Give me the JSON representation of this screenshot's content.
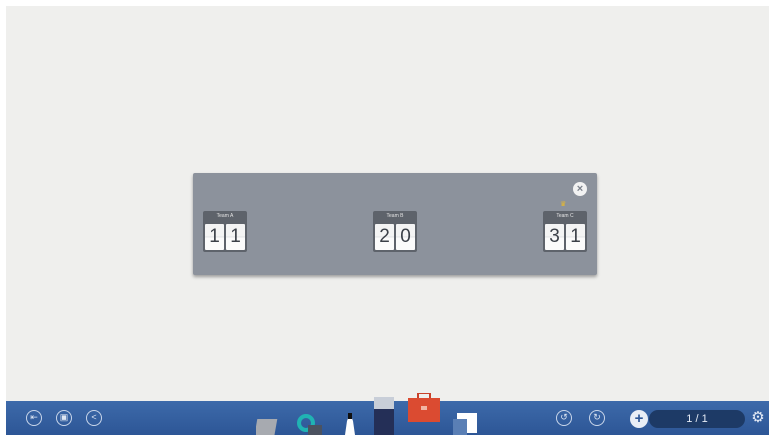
{
  "scoreboard": {
    "close_icon": "×",
    "crown_icon": "♛",
    "teams": [
      {
        "label": "Team A",
        "digits": [
          "1",
          "1"
        ]
      },
      {
        "label": "Team B",
        "digits": [
          "2",
          "0"
        ]
      },
      {
        "label": "Team C",
        "digits": [
          "3",
          "1"
        ]
      }
    ]
  },
  "toolbar": {
    "exit_icon": "⇤",
    "save_icon": "▣",
    "share_icon": "<",
    "undo_icon": "↺",
    "redo_icon": "↻",
    "add_page_icon": "+",
    "page_indicator": "1 / 1",
    "settings_icon": "⚙"
  },
  "colors": {
    "toolbar": "#2d5696",
    "scoreboard": "#8c929c",
    "canvas": "#efefed"
  }
}
